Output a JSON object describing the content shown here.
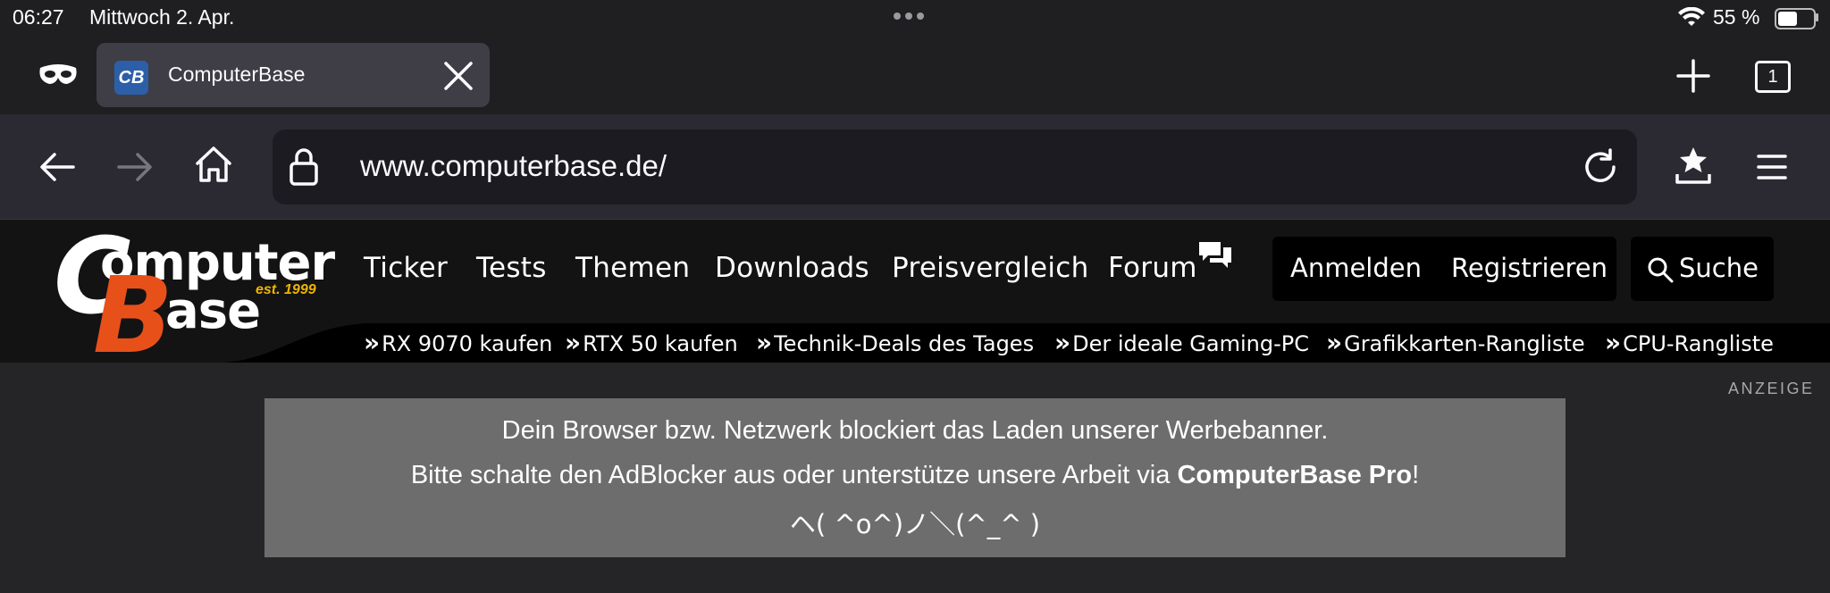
{
  "status_bar": {
    "time": "06:27",
    "date": "Mittwoch 2. Apr.",
    "battery_percent": "55 %",
    "battery_level": 0.55
  },
  "tab": {
    "favicon_text": "CB",
    "title": "ComputerBase"
  },
  "toolbar": {
    "url": "www.computerbase.de/",
    "tabs_count": "1"
  },
  "site": {
    "logo": {
      "line1": "omputer",
      "line2": "ase",
      "est": "est. 1999",
      "brand_color": "#e8501a",
      "tag_color": "#f0b400"
    },
    "nav": [
      "Ticker",
      "Tests",
      "Themen",
      "Downloads",
      "Preisvergleich",
      "Forum"
    ],
    "auth": {
      "login": "Anmelden",
      "register": "Registrieren"
    },
    "search_label": "Suche",
    "quick_links": [
      "RX 9070 kaufen",
      "RTX 50 kaufen",
      "Technik-Deals des Tages",
      "Der ideale Gaming-PC",
      "Grafikkarten-Rangliste",
      "CPU-Rangliste"
    ]
  },
  "ad": {
    "label": "ANZEIGE",
    "line1": "Dein Browser bzw. Netzwerk blockiert das Laden unserer Werbebanner.",
    "line2_pre": "Bitte schalte den AdBlocker aus oder unterstütze unsere Arbeit via ",
    "line2_bold": "ComputerBase Pro",
    "line2_post": "!",
    "line3": "ヘ( ^o^)ノ＼(^_^ )"
  }
}
